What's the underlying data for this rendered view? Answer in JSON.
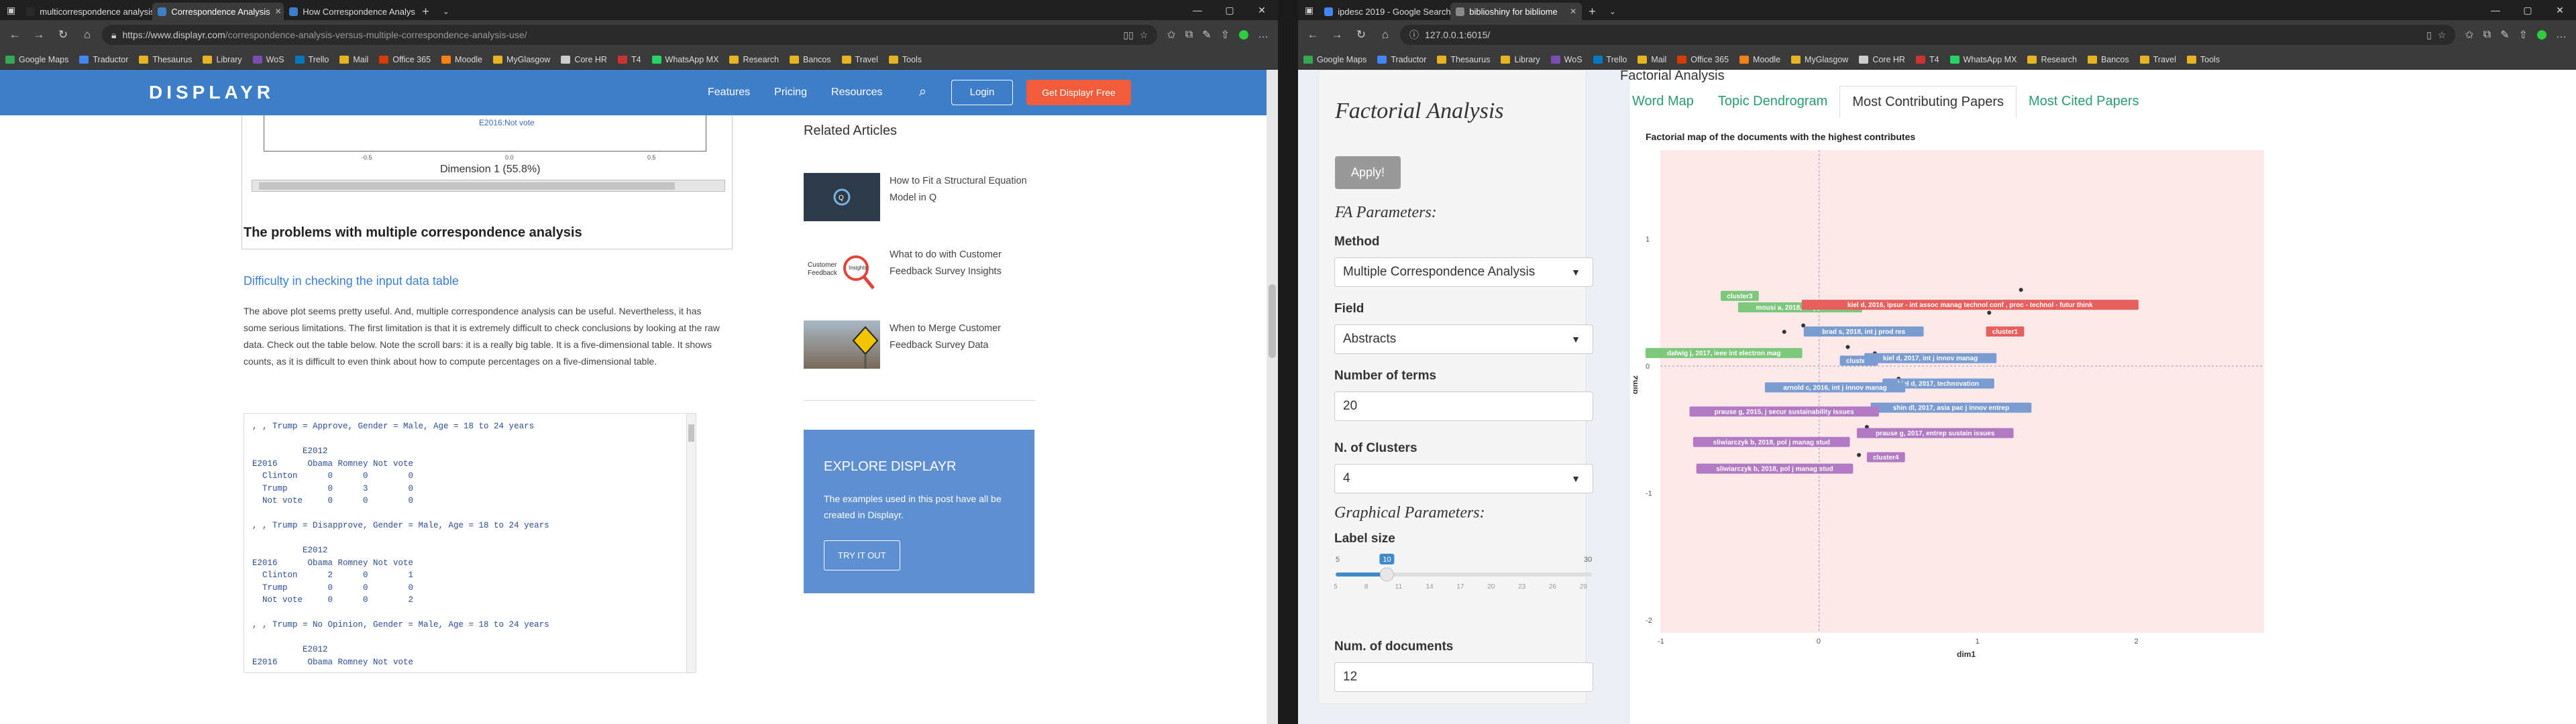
{
  "left_window": {
    "tabs": [
      {
        "label": "multicorrespondence analysis",
        "color": "#2a2a2a",
        "active": false
      },
      {
        "label": "Correspondence Analysis",
        "color": "#3e7ec9",
        "active": true
      },
      {
        "label": "How Correspondence Analysis",
        "color": "#3e7ec9",
        "active": false
      }
    ],
    "url_host": "https://www.displayr.com",
    "url_path": "/correspondence-analysis-versus-multiple-correspondence-analysis-use/",
    "bookmarks": [
      {
        "label": "Google Maps",
        "color": "#34a853"
      },
      {
        "label": "Traductor",
        "color": "#4285f4"
      },
      {
        "label": "Thesaurus",
        "color": "#e6b422"
      },
      {
        "label": "Library",
        "color": "#e6b422"
      },
      {
        "label": "WoS",
        "color": "#7b4db3"
      },
      {
        "label": "Trello",
        "color": "#0079bf"
      },
      {
        "label": "Mail",
        "color": "#e6b422"
      },
      {
        "label": "Office 365",
        "color": "#d83b01"
      },
      {
        "label": "Moodle",
        "color": "#f98012"
      },
      {
        "label": "MyGlasgow",
        "color": "#e6b422"
      },
      {
        "label": "Core HR",
        "color": "#cccccc"
      },
      {
        "label": "T4",
        "color": "#cc3333"
      },
      {
        "label": "WhatsApp MX",
        "color": "#25d366"
      },
      {
        "label": "Research",
        "color": "#e6b422"
      },
      {
        "label": "Bancos",
        "color": "#e6b422"
      },
      {
        "label": "Travel",
        "color": "#e6b422"
      },
      {
        "label": "Tools",
        "color": "#e6b422"
      }
    ],
    "site": {
      "logo": "DISPLAYR",
      "nav": [
        "Features",
        "Pricing",
        "Resources"
      ],
      "login": "Login",
      "cta": "Get Displayr Free"
    },
    "figure": {
      "legend_point": "E2016:Not vote",
      "x_ticks": [
        "-0.5",
        "0.0",
        "0.5"
      ],
      "x_label": "Dimension 1 (55.8%)"
    },
    "article": {
      "heading": "The problems with multiple correspondence analysis",
      "subheading": "Difficulty in checking the input data table",
      "paragraph": "The above plot seems pretty useful. And, multiple correspondence analysis can be useful. Nevertheless, it has some serious limitations. The first limitation is that it is extremely difficult to check conclusions by looking at the raw data. Check out the table below. Note the scroll bars: it is a really big table. It is a five-dimensional table. It shows counts, as it is difficult to even think about how to compute percentages on a five-dimensional table.",
      "code": ", , Trump = Approve, Gender = Male, Age = 18 to 24 years\n\n          E2012\nE2016      Obama Romney Not vote\n  Clinton      0      0        0\n  Trump        0      3        0\n  Not vote     0      0        0\n\n, , Trump = Disapprove, Gender = Male, Age = 18 to 24 years\n\n          E2012\nE2016      Obama Romney Not vote\n  Clinton      2      0        1\n  Trump        0      0        0\n  Not vote     0      0        2\n\n, , Trump = No Opinion, Gender = Male, Age = 18 to 24 years\n\n          E2012\nE2016      Obama Romney Not vote"
    },
    "related": {
      "title": "Related Articles",
      "items": [
        "How to Fit a Structural Equation Model in Q",
        "What to do with Customer Feedback Survey Insights",
        "When to Merge Customer Feedback Survey Data"
      ],
      "thumb2_text": "Customer Feedback",
      "thumb2_badge": "Insights"
    },
    "explore": {
      "title": "EXPLORE DISPLAYR",
      "desc": "The examples used in this post have all be created in Displayr.",
      "button": "TRY IT OUT"
    }
  },
  "right_window": {
    "tabs": [
      {
        "label": "ipdesc 2019 - Google Search",
        "color": "#4285f4",
        "active": false
      },
      {
        "label": "biblioshiny for bibliome",
        "color": "#888888",
        "active": true
      }
    ],
    "url": "127.0.0.1:6015/",
    "app": {
      "page_title": "Factorial Analysis",
      "sidebar_title": "Factorial Analysis",
      "apply": "Apply!",
      "fa_params": "FA Parameters:",
      "method_label": "Method",
      "method_value": "Multiple Correspondence Analysis",
      "field_label": "Field",
      "field_value": "Abstracts",
      "terms_label": "Number of terms",
      "terms_value": "20",
      "clusters_label": "N. of Clusters",
      "clusters_value": "4",
      "graph_params": "Graphical Parameters:",
      "label_size_label": "Label size",
      "label_size": {
        "min": "5",
        "max": "30",
        "value": "10",
        "ticks": [
          "5",
          "8",
          "11",
          "14",
          "17",
          "20",
          "23",
          "26",
          "29"
        ]
      },
      "num_docs_label": "Num. of documents",
      "num_docs_value": "12",
      "tabs": [
        "Word Map",
        "Topic Dendrogram",
        "Most Contributing Papers",
        "Most Cited Papers"
      ],
      "active_tab": "Most Contributing Papers"
    },
    "chart_data": {
      "type": "scatter",
      "title": "Factorial map of the documents with the highest contributes",
      "xlabel": "dim1",
      "ylabel": "dim2",
      "xlim": [
        -1,
        2.8
      ],
      "ylim": [
        -2.1,
        1.7
      ],
      "x_ticks": [
        "-1",
        "0",
        "1",
        "2"
      ],
      "y_ticks": [
        "1",
        "0",
        "-1",
        "-2"
      ],
      "grid": false,
      "background": "#fde8ea",
      "cluster_colors": {
        "green": "#7dc87d",
        "red": "#e8605e",
        "blue": "#7a9cd0",
        "purple": "#b27ac2"
      },
      "points": [
        {
          "label": "cluster3",
          "x": -0.55,
          "y": 0.57,
          "lx": -0.5,
          "ly": 0.55,
          "cluster": "green"
        },
        {
          "label": "mousi a, 2018, int j prod res",
          "x": -0.35,
          "y": 0.48,
          "lx": -0.12,
          "ly": 0.46,
          "cluster": "green"
        },
        {
          "label": "brad s, 2018, int j prod res",
          "x": -0.1,
          "y": 0.32,
          "lx": 0.28,
          "ly": 0.27,
          "cluster": "blue"
        },
        {
          "label": "dalwig j, 2017, ieee int electron mag",
          "x": -0.22,
          "y": 0.27,
          "lx": -0.6,
          "ly": 0.1,
          "cluster": "green"
        },
        {
          "label": "cluster2",
          "x": 0.18,
          "y": 0.15,
          "lx": 0.25,
          "ly": 0.04,
          "cluster": "blue"
        },
        {
          "label": "kiel d, 2017, int j innov manag",
          "x": 0.35,
          "y": 0.1,
          "lx": 0.7,
          "ly": 0.06,
          "cluster": "blue"
        },
        {
          "label": "kiel d, 2017, technovation",
          "x": 0.5,
          "y": -0.1,
          "lx": 0.75,
          "ly": -0.14,
          "cluster": "blue"
        },
        {
          "label": "arnold c, 2016, int j innov manag",
          "x": 0.1,
          "y": -0.18,
          "lx": 0.1,
          "ly": -0.17,
          "cluster": "blue"
        },
        {
          "label": "shin dl, 2017, asia pac j innov entrep",
          "x": 0.4,
          "y": -0.33,
          "lx": 0.83,
          "ly": -0.33,
          "cluster": "blue"
        },
        {
          "label": "prause g, 2015, j secur sustainability issues",
          "x": 0.18,
          "y": -0.36,
          "lx": -0.22,
          "ly": -0.36,
          "cluster": "purple"
        },
        {
          "label": "prause g, 2017, entrep sustain issues",
          "x": 0.3,
          "y": -0.48,
          "lx": 0.73,
          "ly": -0.53,
          "cluster": "purple"
        },
        {
          "label": "sliwiarczyk b, 2018, pol j manag stud",
          "x": 0.05,
          "y": -0.58,
          "lx": -0.3,
          "ly": -0.6,
          "cluster": "purple"
        },
        {
          "label": "cluster4",
          "x": 0.25,
          "y": -0.7,
          "lx": 0.42,
          "ly": -0.72,
          "cluster": "purple"
        },
        {
          "label": "sliwiarczyk b, 2018, pol j manag stud",
          "x": 0.1,
          "y": -0.8,
          "lx": -0.28,
          "ly": -0.81,
          "cluster": "purple"
        },
        {
          "label": "kiel d, 2016, ipsur - int assoc manag technol conf , proc - technol - futur think",
          "x": 1.27,
          "y": 0.6,
          "lx": 0.95,
          "ly": 0.48,
          "cluster": "red"
        },
        {
          "label": "cluster1",
          "x": 1.07,
          "y": 0.42,
          "lx": 1.17,
          "ly": 0.27,
          "cluster": "red"
        }
      ]
    }
  }
}
